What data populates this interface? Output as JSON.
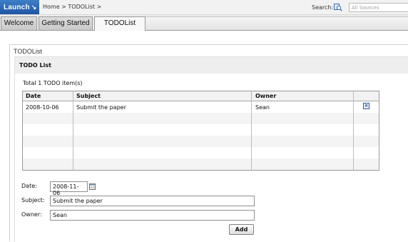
{
  "topbar": {
    "launch_label": "Launch",
    "launch_arrow": "↘",
    "breadcrumb": "Home > TODOList >",
    "search_label": "Search:",
    "search_placeholder": "All Sources",
    "search_icon": "search-sources-icon"
  },
  "tabs": [
    {
      "label": "Welcome",
      "active": false
    },
    {
      "label": "Getting Started",
      "active": false
    },
    {
      "label": "TODOList",
      "active": true
    }
  ],
  "panel": {
    "title": "TODOList",
    "inner_title": "TODO List",
    "total_text": "Total 1 TODO item(s)"
  },
  "table": {
    "columns": [
      "Date",
      "Subject",
      "Owner"
    ],
    "rows": [
      {
        "date": "2008-10-06",
        "subject": "Submit the paper",
        "owner": "Sean",
        "action_icon": "delete-icon"
      }
    ]
  },
  "form": {
    "date_label": "Date:",
    "date_value": "2008-11-06",
    "subject_label": "Subject:",
    "subject_value": "Submit the paper",
    "owner_label": "Owner:",
    "owner_value": "Sean",
    "add_label": "Add",
    "calendar_icon": "calendar-icon"
  },
  "colors": {
    "launch_blue": "#1e56a3",
    "delete_icon_blue": "#2a5a9c"
  }
}
